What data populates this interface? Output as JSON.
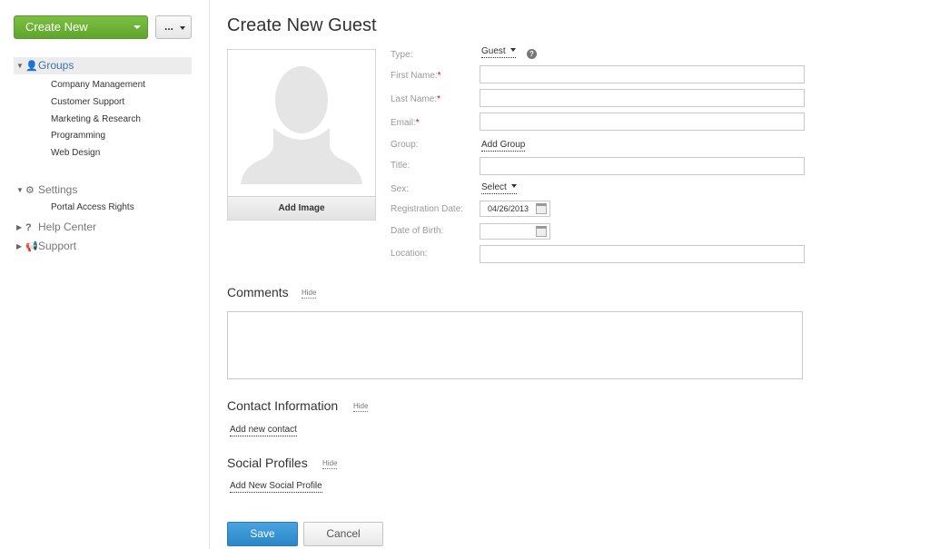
{
  "sidebar": {
    "create_new_label": "Create New",
    "more_label": "...",
    "groups": {
      "label": "Groups",
      "icon": "user-icon",
      "items": [
        "Company Management",
        "Customer Support",
        "Marketing & Research",
        "Programming",
        "Web Design"
      ]
    },
    "settings": {
      "label": "Settings",
      "icon": "gear-icon",
      "items": [
        "Portal Access Rights"
      ]
    },
    "help_center": {
      "label": "Help Center",
      "icon": "question-icon"
    },
    "support": {
      "label": "Support",
      "icon": "megaphone-icon"
    }
  },
  "page": {
    "title": "Create New Guest"
  },
  "photo": {
    "add_image_label": "Add Image"
  },
  "form": {
    "type": {
      "label": "Type:",
      "value": "Guest"
    },
    "first_name": {
      "label": "First Name:",
      "required_mark": "*",
      "value": ""
    },
    "last_name": {
      "label": "Last Name:",
      "required_mark": "*",
      "value": ""
    },
    "email": {
      "label": "Email:",
      "required_mark": "*",
      "value": ""
    },
    "group": {
      "label": "Group:",
      "link": "Add Group"
    },
    "title": {
      "label": "Title:",
      "value": ""
    },
    "sex": {
      "label": "Sex:",
      "value": "Select"
    },
    "registration_date": {
      "label": "Registration Date:",
      "value": "04/26/2013"
    },
    "date_of_birth": {
      "label": "Date of Birth:",
      "value": ""
    },
    "location": {
      "label": "Location:",
      "value": ""
    }
  },
  "sections": {
    "comments": {
      "title": "Comments",
      "hide": "Hide"
    },
    "contact": {
      "title": "Contact Information",
      "hide": "Hide",
      "add_link": "Add new contact"
    },
    "social": {
      "title": "Social Profiles",
      "hide": "Hide",
      "add_link": "Add New Social Profile"
    }
  },
  "actions": {
    "save": "Save",
    "cancel": "Cancel"
  },
  "colors": {
    "create_btn": "#6cb33a",
    "save_btn": "#3a95d6",
    "link_active": "#3f70a8",
    "required": "#dd0000"
  }
}
